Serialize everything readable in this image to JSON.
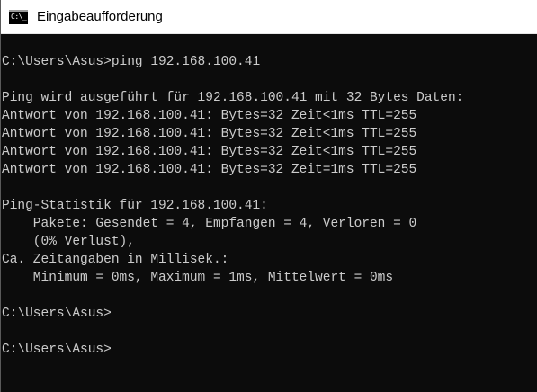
{
  "window": {
    "title": "Eingabeaufforderung",
    "icon_name": "command-prompt-icon",
    "icon_glyph": "C:\\_"
  },
  "colors": {
    "background": "#0c0c0c",
    "text": "#cccccc",
    "titlebar": "#ffffff"
  },
  "console": {
    "lines": [
      "C:\\Users\\Asus>ping 192.168.100.41",
      "",
      "Ping wird ausgeführt für 192.168.100.41 mit 32 Bytes Daten:",
      "Antwort von 192.168.100.41: Bytes=32 Zeit<1ms TTL=255",
      "Antwort von 192.168.100.41: Bytes=32 Zeit<1ms TTL=255",
      "Antwort von 192.168.100.41: Bytes=32 Zeit<1ms TTL=255",
      "Antwort von 192.168.100.41: Bytes=32 Zeit=1ms TTL=255",
      "",
      "Ping-Statistik für 192.168.100.41:",
      "    Pakete: Gesendet = 4, Empfangen = 4, Verloren = 0",
      "    (0% Verlust),",
      "Ca. Zeitangaben in Millisek.:",
      "    Minimum = 0ms, Maximum = 1ms, Mittelwert = 0ms",
      "",
      "C:\\Users\\Asus>",
      "",
      "C:\\Users\\Asus>"
    ]
  }
}
